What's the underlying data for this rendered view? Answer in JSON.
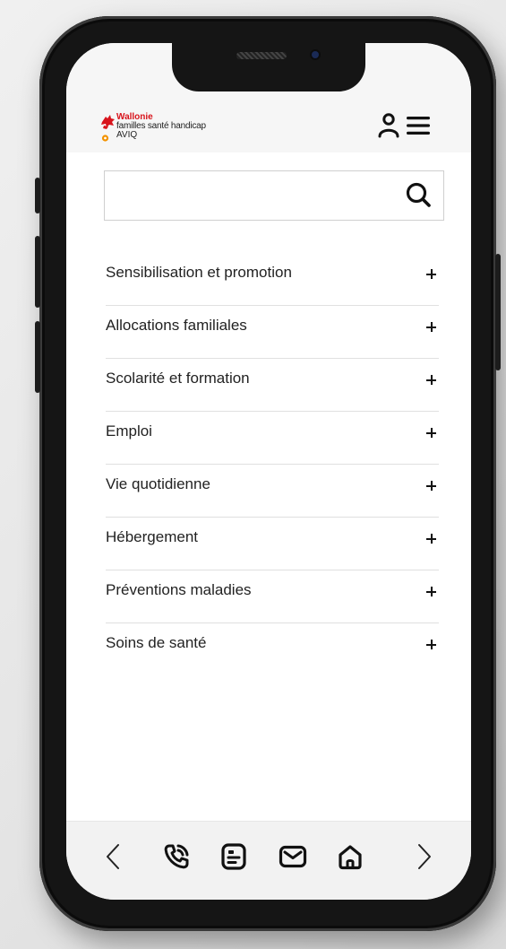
{
  "header": {
    "logo": {
      "line1": "Wallonie",
      "line2": "familles santé handicap",
      "line3": "AVIQ",
      "colors": {
        "red": "#d8141c",
        "orange": "#f39200"
      }
    },
    "icons": [
      "user-icon",
      "hamburger-menu-icon"
    ]
  },
  "search": {
    "value": "",
    "placeholder": "",
    "icon": "search-icon"
  },
  "menu": {
    "items": [
      {
        "label": "Sensibilisation et promotion",
        "icon": "plus-icon"
      },
      {
        "label": "Allocations familiales",
        "icon": "plus-icon"
      },
      {
        "label": "Scolarité et formation",
        "icon": "plus-icon"
      },
      {
        "label": "Emploi",
        "icon": "plus-icon"
      },
      {
        "label": "Vie quotidienne",
        "icon": "plus-icon"
      },
      {
        "label": "Hébergement",
        "icon": "plus-icon"
      },
      {
        "label": "Préventions maladies",
        "icon": "plus-icon"
      },
      {
        "label": "Soins de santé",
        "icon": "plus-icon"
      }
    ]
  },
  "bottom_bar": {
    "icons": [
      "chevron-left-icon",
      "phone-icon",
      "document-icon",
      "mail-icon",
      "home-icon",
      "chevron-right-icon"
    ]
  },
  "colors": {
    "accent": "#d8141c",
    "text": "#222222",
    "bar_background": "#f2f2f2"
  }
}
